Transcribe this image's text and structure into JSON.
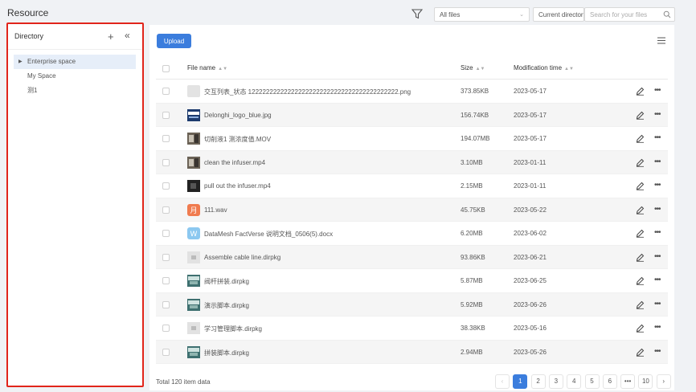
{
  "app": {
    "title": "Resource"
  },
  "toolbar": {
    "filter_icon": "filter-icon",
    "scope_select": "All files",
    "location_select": "Current directory",
    "search_placeholder": "Search for your files"
  },
  "sidebar": {
    "title": "Directory",
    "add_icon": "+",
    "collapse_icon": "«",
    "items": [
      {
        "label": "Enterprise space",
        "expandable": true
      },
      {
        "label": "My Space",
        "expandable": false
      },
      {
        "label": "测1",
        "expandable": false
      }
    ]
  },
  "main": {
    "upload_label": "Upload",
    "columns": {
      "name": "File name",
      "size": "Size",
      "mtime": "Modification time"
    },
    "rows": [
      {
        "name": "交互列表_状态 122222222222222222222222222222222222222222.png",
        "size": "373.85KB",
        "mtime": "2023-05-17",
        "thumb": "png"
      },
      {
        "name": "Delonghi_logo_blue.jpg",
        "size": "156.74KB",
        "mtime": "2023-05-17",
        "thumb": "logo"
      },
      {
        "name": "切削液1 测浓度值.MOV",
        "size": "194.07MB",
        "mtime": "2023-05-17",
        "thumb": "video"
      },
      {
        "name": "clean the infuser.mp4",
        "size": "3.10MB",
        "mtime": "2023-01-11",
        "thumb": "video"
      },
      {
        "name": "pull out the infuser.mp4",
        "size": "2.15MB",
        "mtime": "2023-01-11",
        "thumb": "dark"
      },
      {
        "name": "111.wav",
        "size": "45.75KB",
        "mtime": "2023-05-22",
        "thumb": "audio"
      },
      {
        "name": "DataMesh FactVerse 说明文档_0506(5).docx",
        "size": "6.20MB",
        "mtime": "2023-06-02",
        "thumb": "doc"
      },
      {
        "name": "Assemble cable line.dirpkg",
        "size": "93.86KB",
        "mtime": "2023-06-21",
        "thumb": "pkg-light"
      },
      {
        "name": "阀杆拼装.dirpkg",
        "size": "5.87MB",
        "mtime": "2023-06-25",
        "thumb": "pkg"
      },
      {
        "name": "演示脚本.dirpkg",
        "size": "5.92MB",
        "mtime": "2023-06-26",
        "thumb": "pkg"
      },
      {
        "name": "学习管理脚本.dirpkg",
        "size": "38.38KB",
        "mtime": "2023-05-16",
        "thumb": "pkg-light"
      },
      {
        "name": "拼装脚本.dirpkg",
        "size": "2.94MB",
        "mtime": "2023-05-26",
        "thumb": "pkg"
      }
    ],
    "total": "Total 120 item data",
    "pagination": {
      "prev": "‹",
      "pages": [
        "1",
        "2",
        "3",
        "4",
        "5",
        "6"
      ],
      "ellipsis": "•••",
      "last": "10",
      "next": "›",
      "current": "1"
    }
  },
  "colors": {
    "accent": "#3b7ddd",
    "highlight_border": "#e1251b",
    "tree_active": "#e6eef9"
  }
}
